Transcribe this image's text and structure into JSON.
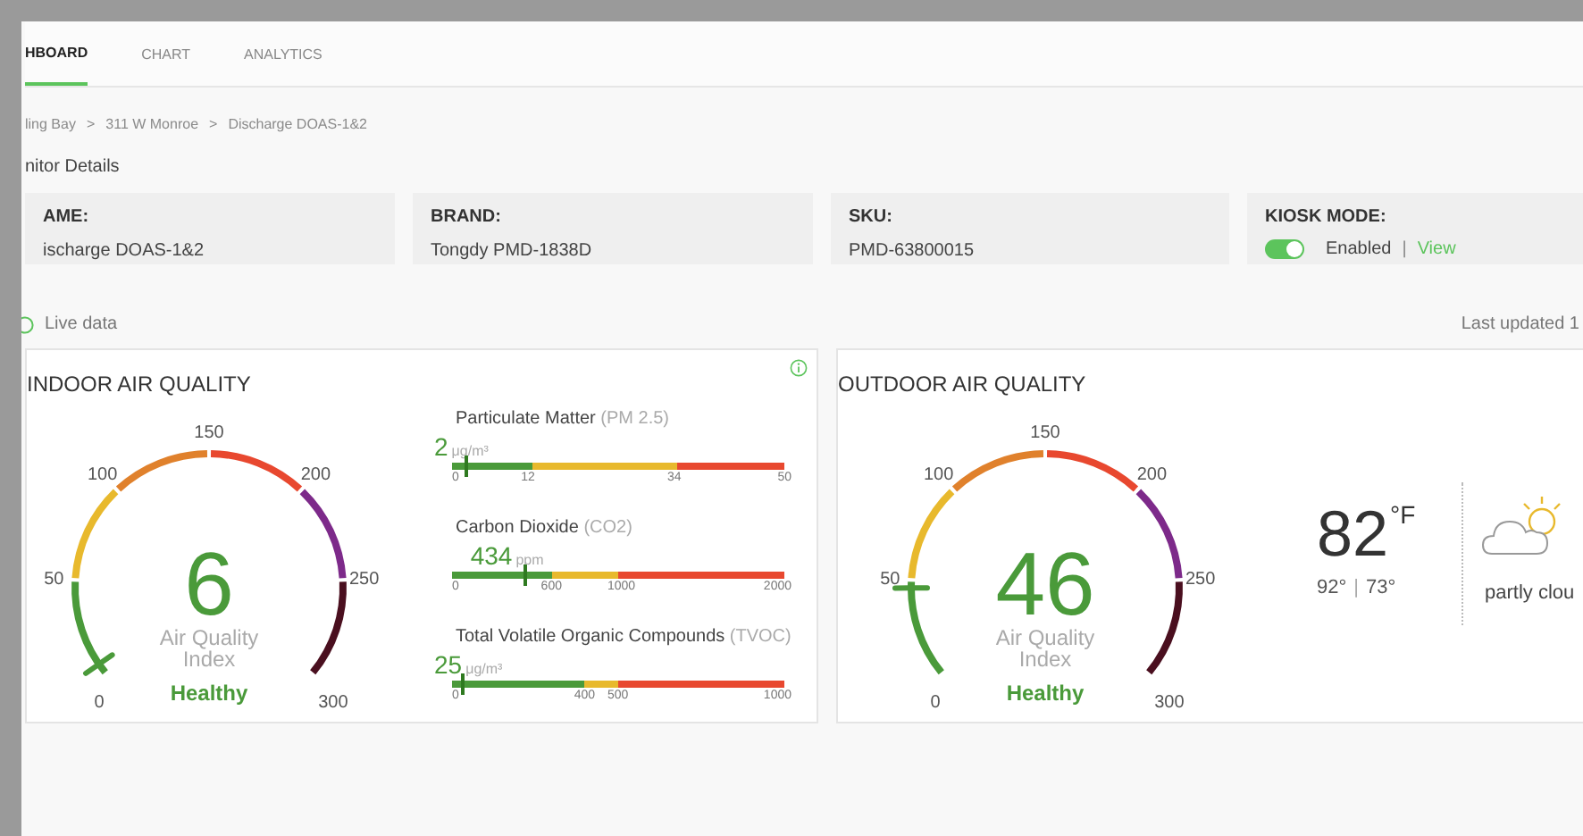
{
  "tabs": [
    {
      "label": "HBOARD",
      "selected": true
    },
    {
      "label": "CHART",
      "selected": false
    },
    {
      "label": "ANALYTICS",
      "selected": false
    }
  ],
  "breadcrumb": {
    "items": [
      "ling Bay",
      "311 W Monroe",
      "Discharge DOAS-1&2"
    ],
    "separator": ">"
  },
  "section_title": "nitor Details",
  "info_cards": [
    {
      "kind": "text",
      "label": "AME:",
      "value": "ischarge DOAS-1&2"
    },
    {
      "kind": "text",
      "label": "BRAND:",
      "value": "Tongdy PMD-1838D"
    },
    {
      "kind": "text",
      "label": "SKU:",
      "value": "PMD-63800015"
    },
    {
      "kind": "toggle",
      "label": "KIOSK MODE:",
      "on": true,
      "status": "Enabled",
      "separator": "|",
      "link": "View"
    }
  ],
  "live_data": {
    "label": "Live data"
  },
  "last_updated": "Last updated 1",
  "indoor": {
    "title": "INDOOR AIR QUALITY",
    "gauge": {
      "value": "6",
      "caption": [
        "Air Quality",
        "Index"
      ],
      "status": "Healthy",
      "scale": [
        "0",
        "50",
        "100",
        "150",
        "200",
        "250",
        "300"
      ],
      "bands": [
        {
          "color": "#4a9a3a"
        },
        {
          "color": "#e8b92d"
        },
        {
          "color": "#e0812c"
        },
        {
          "color": "#e8482f"
        },
        {
          "color": "#7d2a8a"
        },
        {
          "color": "#4a0f1f"
        }
      ]
    },
    "metrics": [
      {
        "name": "Particulate Matter",
        "code": "(PM 2.5)",
        "value": "2",
        "unit": "μg/m³",
        "level": 0.04,
        "start": "0",
        "segments": [
          {
            "end": "12",
            "color": "#4a9a3a"
          },
          {
            "end": "34",
            "color": "#e8b92d"
          },
          {
            "end": "50",
            "color": "#e8482f"
          }
        ]
      },
      {
        "name": "Carbon Dioxide",
        "code": "(CO2)",
        "value": "434",
        "unit": "ppm",
        "level": 0.217,
        "start": "0",
        "segments": [
          {
            "end": "600",
            "color": "#4a9a3a"
          },
          {
            "end": "1000",
            "color": "#e8b92d"
          },
          {
            "end": "2000",
            "color": "#e8482f"
          }
        ]
      },
      {
        "name": "Total Volatile Organic Compounds",
        "code": "(TVOC)",
        "value": "25",
        "unit": "μg/m³",
        "level": 0.025,
        "start": "0",
        "segments": [
          {
            "end": "400",
            "color": "#4a9a3a"
          },
          {
            "end": "500",
            "color": "#e8b92d"
          },
          {
            "end": "1000",
            "color": "#e8482f"
          }
        ]
      }
    ]
  },
  "outdoor": {
    "title": "OUTDOOR AIR QUALITY",
    "gauge": {
      "value": "46",
      "caption": [
        "Air Quality",
        "Index"
      ],
      "status": "Healthy",
      "scale": [
        "0",
        "50",
        "100",
        "150",
        "200",
        "250",
        "300"
      ],
      "bands": [
        {
          "color": "#4a9a3a"
        },
        {
          "color": "#e8b92d"
        },
        {
          "color": "#e0812c"
        },
        {
          "color": "#e8482f"
        },
        {
          "color": "#7d2a8a"
        },
        {
          "color": "#4a0f1f"
        }
      ]
    },
    "weather": {
      "temperature": "82",
      "unit": "°F",
      "high": "92°",
      "separator": "|",
      "low": "73°",
      "condition": "partly clou"
    }
  }
}
